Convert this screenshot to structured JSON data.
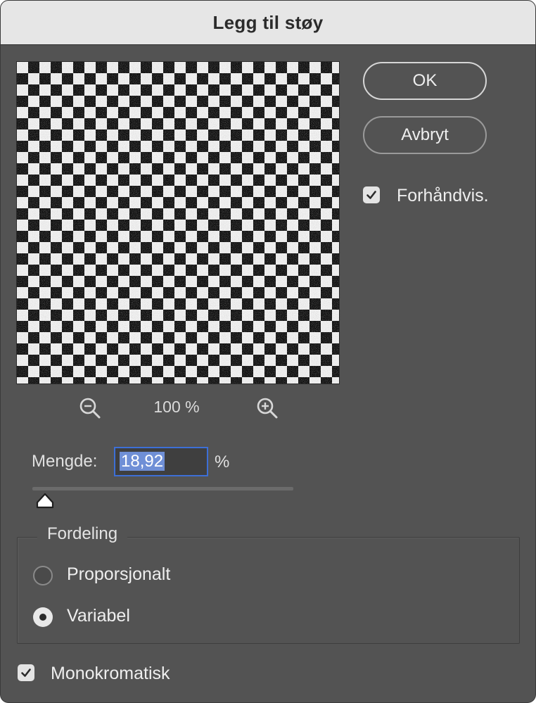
{
  "dialog": {
    "title": "Legg til støy"
  },
  "buttons": {
    "ok_label": "OK",
    "cancel_label": "Avbryt"
  },
  "preview_option": {
    "label": "Forhåndvis.",
    "checked": true
  },
  "zoom": {
    "level": "100 %",
    "zoom_out_icon": "zoom-out-icon",
    "zoom_in_icon": "zoom-in-icon"
  },
  "amount": {
    "label": "Mengde:",
    "value": "18,92",
    "unit": "%",
    "slider_fraction": 0.0473
  },
  "distribution": {
    "legend": "Fordeling",
    "options": [
      {
        "label": "Proporsjonalt",
        "selected": false
      },
      {
        "label": "Variabel",
        "selected": true
      }
    ]
  },
  "monochrome": {
    "label": "Monokromatisk",
    "checked": true
  },
  "colors": {
    "dialog_bg": "#535353",
    "titlebar_bg": "#e6e6e6",
    "focus_blue": "#3d6fd6",
    "selection_blue": "#6f8fd6"
  }
}
